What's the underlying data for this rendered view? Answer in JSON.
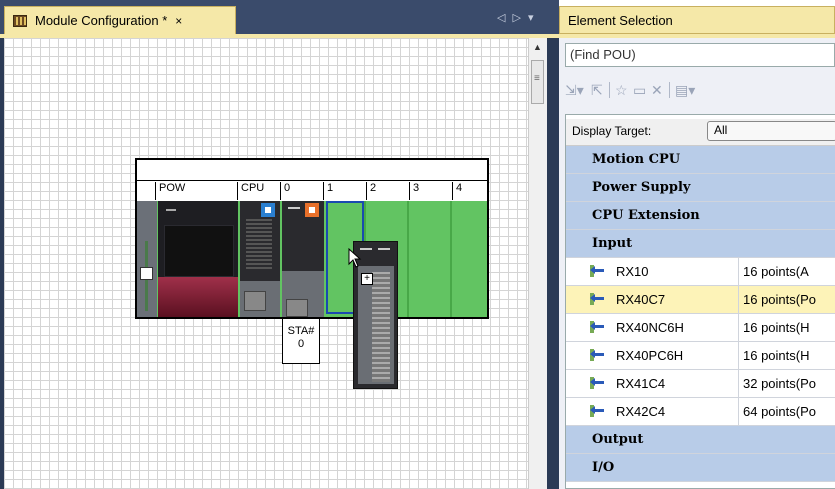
{
  "left_tab": {
    "title": "Module Configuration *",
    "close": "×",
    "nav": "◁ ▷ ▾"
  },
  "base": {
    "slot_labels": [
      "POW",
      "CPU",
      "0",
      "1",
      "2",
      "3",
      "4"
    ],
    "station_label": "STA#",
    "station_number": "0"
  },
  "drag_plus": "+",
  "right_panel": {
    "title": "Element Selection",
    "find_placeholder": "(Find POU)",
    "toolbar_icons": [
      "expand-icon",
      "collapse-icon",
      "favorite-icon",
      "folder-icon",
      "delete-icon",
      "display-icon"
    ],
    "display_target_label": "Display Target:",
    "display_target_value": "All",
    "categories": {
      "motion_cpu": "Motion CPU",
      "power_supply": "Power Supply",
      "cpu_extension": "CPU Extension",
      "input": "Input",
      "output": "Output",
      "io": "I/O"
    },
    "items": [
      {
        "name": "RX10",
        "desc": "16 points(A"
      },
      {
        "name": "RX40C7",
        "desc": "16 points(Po"
      },
      {
        "name": "RX40NC6H",
        "desc": "16 points(H"
      },
      {
        "name": "RX40PC6H",
        "desc": "16 points(H"
      },
      {
        "name": "RX41C4",
        "desc": "32 points(Po"
      },
      {
        "name": "RX42C4",
        "desc": "64 points(Po"
      }
    ],
    "selected_item": "RX40C7"
  }
}
